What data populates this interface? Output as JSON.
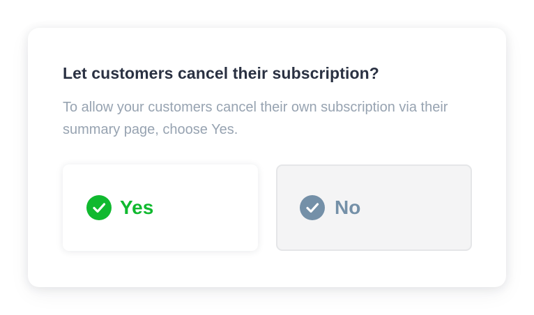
{
  "question": {
    "title": "Let customers cancel their subscription?",
    "description": "To allow your customers cancel their own subscription via their summary page, choose Yes."
  },
  "options": [
    {
      "label": "Yes",
      "icon": "check-circle-icon",
      "color": "#10b92f",
      "selected": true
    },
    {
      "label": "No",
      "icon": "check-circle-icon",
      "color": "#7490a8",
      "selected": false
    }
  ]
}
